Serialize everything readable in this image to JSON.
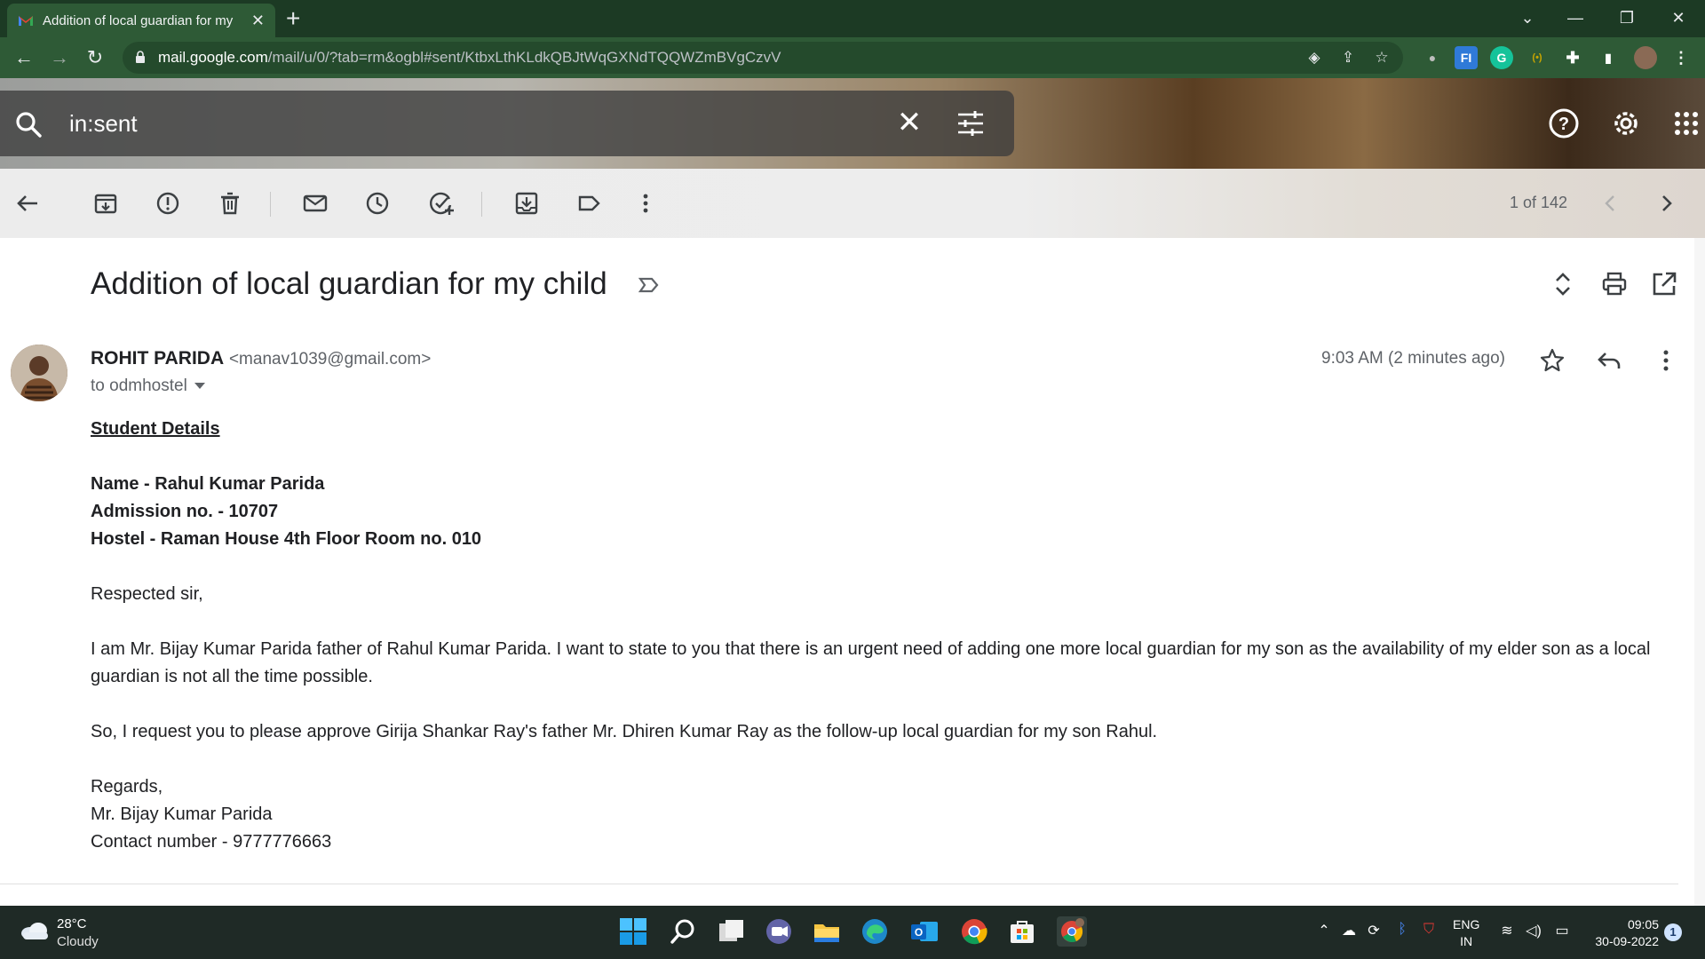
{
  "browser": {
    "tab_title": "Addition of local guardian for my",
    "new_tab_label": "+",
    "url_host": "mail.google.com",
    "url_path": "/mail/u/0/?tab=rm&ogbl#sent/KtbxLthKLdkQBJtWqGXNdTQQWZmBVgCzvV"
  },
  "search": {
    "query": "in:sent"
  },
  "toolbar": {
    "pager": "1 of 142"
  },
  "email": {
    "subject": "Addition of local guardian for my child",
    "sender_name": "ROHIT PARIDA",
    "sender_email": "<manav1039@gmail.com>",
    "recipient": "to odmhostel",
    "timestamp": "9:03 AM (2 minutes ago)",
    "body": {
      "heading": "Student Details",
      "name_line": "Name - Rahul Kumar Parida",
      "admission_line": "Admission no. - 10707",
      "hostel_line": "Hostel - Raman House 4th Floor Room no. 010",
      "greeting": "Respected sir,",
      "paragraph1": "I am Mr. Bijay Kumar Parida father of Rahul Kumar Parida. I want to state to you that there is an urgent need of adding one more local guardian for my son as the availability of my elder son as a local guardian is not all the time possible.",
      "paragraph2": "So, I request you to please approve Girija Shankar Ray's father Mr. Dhiren Kumar Ray as the follow-up local guardian for my son Rahul.",
      "closing": "Regards,",
      "signature_name": "Mr. Bijay Kumar Parida",
      "contact": "Contact number - 9777776663"
    }
  },
  "taskbar": {
    "temperature": "28°C",
    "weather": "Cloudy",
    "lang_1": "ENG",
    "lang_2": "IN",
    "time": "09:05",
    "date": "30-09-2022",
    "notification_count": "1"
  },
  "colors": {
    "chrome_frame": "#1c3a24",
    "chrome_toolbar": "#2e5a36",
    "taskbar": "#1f2a26",
    "text_primary": "#202124",
    "text_secondary": "#5f6368"
  }
}
